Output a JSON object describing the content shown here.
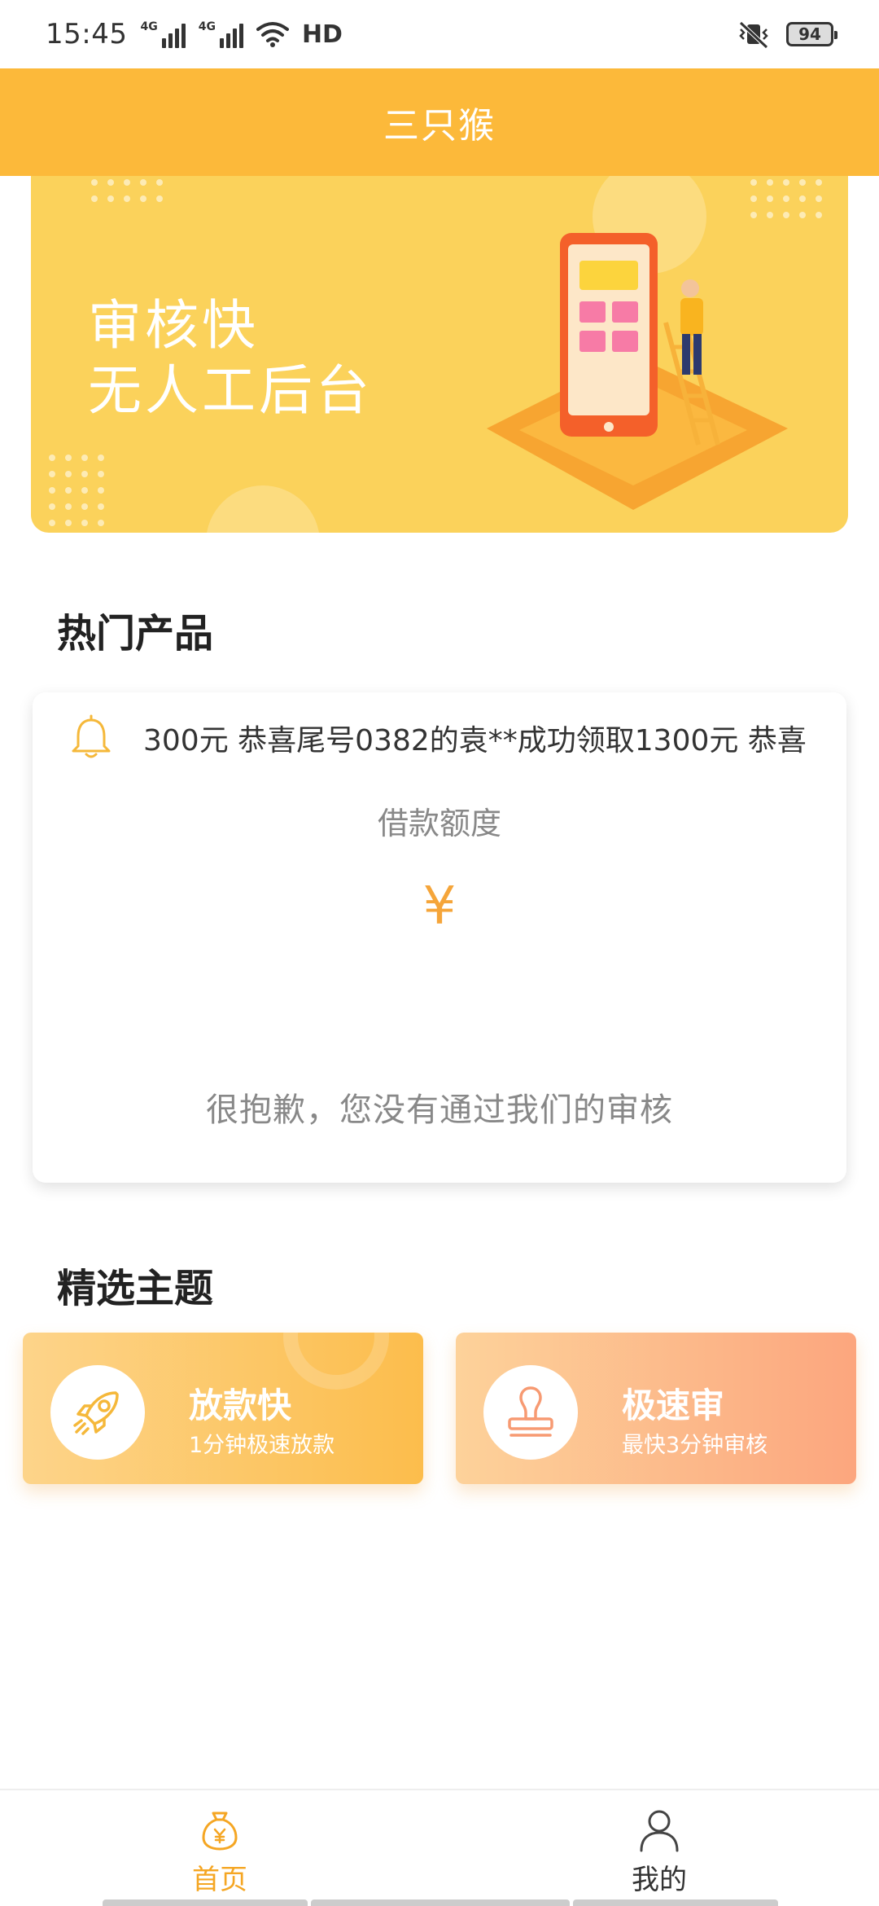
{
  "status_bar": {
    "time": "15:45",
    "network_1": "4G",
    "network_2": "4G",
    "hd": "HD",
    "battery": "94"
  },
  "header": {
    "title": "三只猴"
  },
  "banner": {
    "line1": "审核快",
    "line2": "无人工后台"
  },
  "products": {
    "section_title": "热门产品",
    "notice": "300元 恭喜尾号0382的袁**成功领取1300元 恭喜",
    "amount_label": "借款额度",
    "currency": "¥",
    "message": "很抱歉，您没有通过我们的审核"
  },
  "themes": {
    "section_title": "精选主题",
    "items": [
      {
        "title": "放款快",
        "subtitle": "1分钟极速放款",
        "icon": "rocket-icon"
      },
      {
        "title": "极速审",
        "subtitle": "最快3分钟审核",
        "icon": "stamp-icon"
      }
    ]
  },
  "bottom_nav": {
    "items": [
      {
        "label": "首页",
        "icon": "money-bag-icon",
        "active": true
      },
      {
        "label": "我的",
        "icon": "person-icon",
        "active": false
      }
    ]
  },
  "colors": {
    "brand": "#fcb93a",
    "banner": "#fbd25b",
    "accent_text": "#f5a623"
  }
}
